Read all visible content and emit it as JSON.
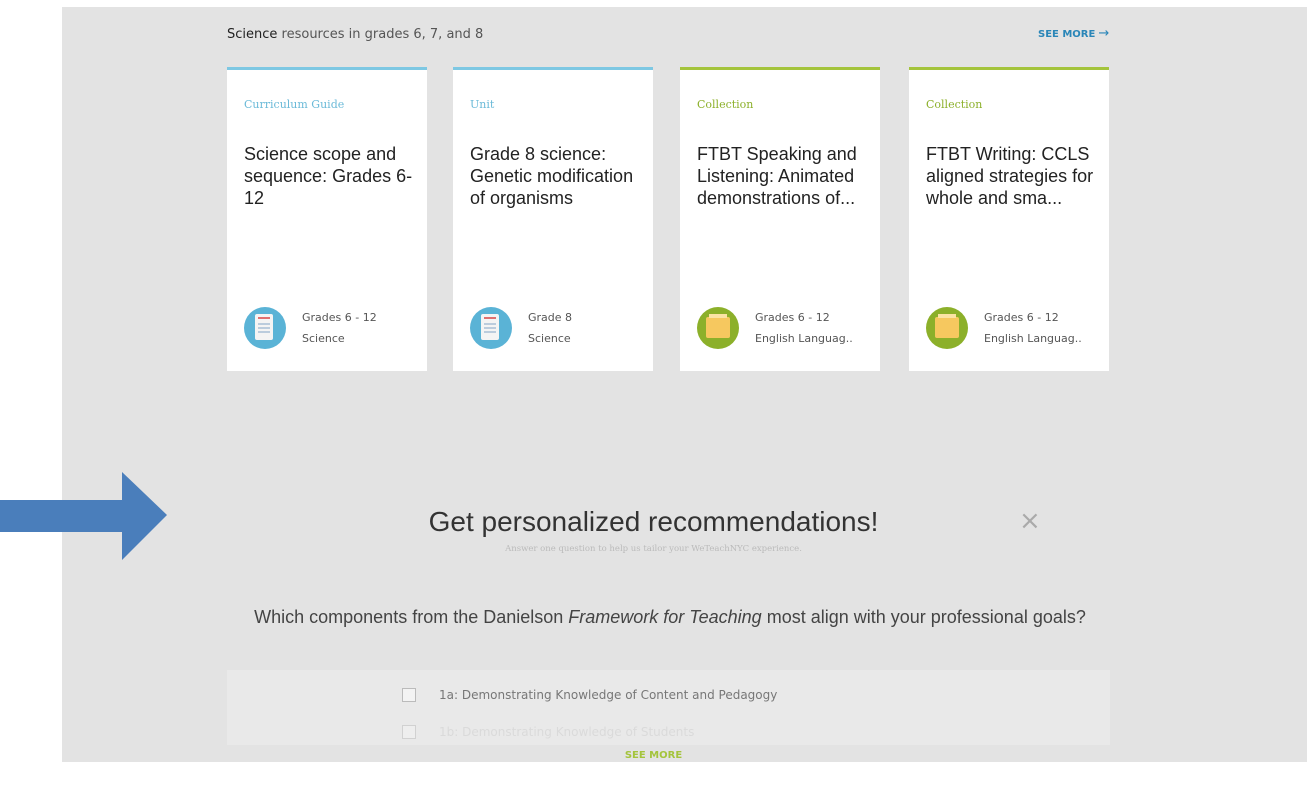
{
  "section": {
    "subject": "Science",
    "rest": " resources in grades 6, 7, and 8",
    "see_more": "SEE MORE",
    "see_more_arrow": "→"
  },
  "cards": [
    {
      "type": "Curriculum Guide",
      "title": "Science scope and sequence: Grades 6-12",
      "grades": "Grades 6 - 12",
      "subject": "Science",
      "icon": "document-icon",
      "color": "#5ab3d6"
    },
    {
      "type": "Unit",
      "title": "Grade 8 science: Genetic modification of organisms",
      "grades": "Grade 8",
      "subject": "Science",
      "icon": "document-icon",
      "color": "#5ab3d6"
    },
    {
      "type": "Collection",
      "title": "FTBT Speaking and Listening: Animated demonstrations of...",
      "grades": "Grades 6 - 12",
      "subject": "English Languag..",
      "icon": "folder-icon",
      "color": "#8cb02a"
    },
    {
      "type": "Collection",
      "title": "FTBT Writing: CCLS aligned strategies for whole and sma...",
      "grades": "Grades 6 - 12",
      "subject": "English Languag..",
      "icon": "folder-icon",
      "color": "#8cb02a"
    }
  ],
  "recommend": {
    "title": "Get personalized recommendations!",
    "close": "×",
    "subtitle": "Answer one question to help us tailor your WeTeachNYC experience.",
    "question_pre": "Which components from the Danielson ",
    "question_em": "Framework for Teaching",
    "question_post": " most align with your professional goals?",
    "options": [
      "1a: Demonstrating Knowledge of Content and Pedagogy",
      "1b: Demonstrating Knowledge of Students"
    ],
    "see_more": "SEE MORE"
  },
  "colors": {
    "blue_accent": "#7ec8e3",
    "green_accent": "#a4c43c",
    "link_blue": "#2a86b8",
    "annotation_arrow": "#4a7ebb"
  }
}
